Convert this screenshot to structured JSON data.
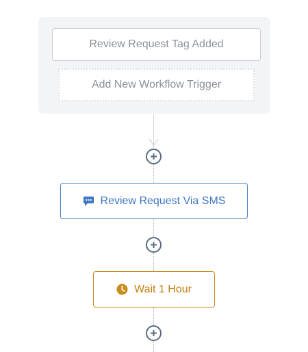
{
  "trigger": {
    "label": "Review Request Tag Added",
    "add_label": "Add New Workflow Trigger"
  },
  "actions": [
    {
      "label": "Review Request Via SMS",
      "icon": "chat-bubble-icon",
      "color": "#3e78c2"
    },
    {
      "label": "Wait 1 Hour",
      "icon": "clock-icon",
      "color": "#c07f0c"
    }
  ],
  "add_step_icon": "plus-circle-icon",
  "colors": {
    "panel_bg": "#f3f4f6",
    "connector": "#b9c3cc",
    "plus": "#5a6b82",
    "sms_border": "#4f83c7",
    "wait_border": "#c98b1a"
  }
}
